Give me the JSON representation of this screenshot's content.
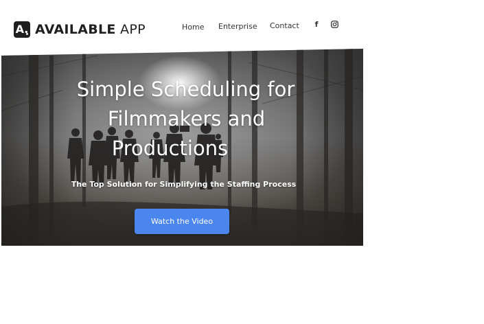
{
  "brand": {
    "logo_letter": "A.",
    "name_bold": "AVAILABLE",
    "name_light": " APP"
  },
  "nav": {
    "items": [
      {
        "label": "Home"
      },
      {
        "label": "Enterprise"
      },
      {
        "label": "Contact"
      }
    ],
    "social": [
      {
        "icon": "facebook-icon",
        "glyph": "f"
      },
      {
        "icon": "instagram-icon"
      }
    ]
  },
  "hero": {
    "title_lines": [
      "Simple Scheduling for",
      "Filmmakers and",
      "Productions"
    ],
    "subtitle": "The Top Solution for Simplifying the Staffing Process",
    "cta_label": "Watch the Video"
  },
  "colors": {
    "cta": "#4a86ee",
    "text_dark": "#1f1f1f"
  }
}
